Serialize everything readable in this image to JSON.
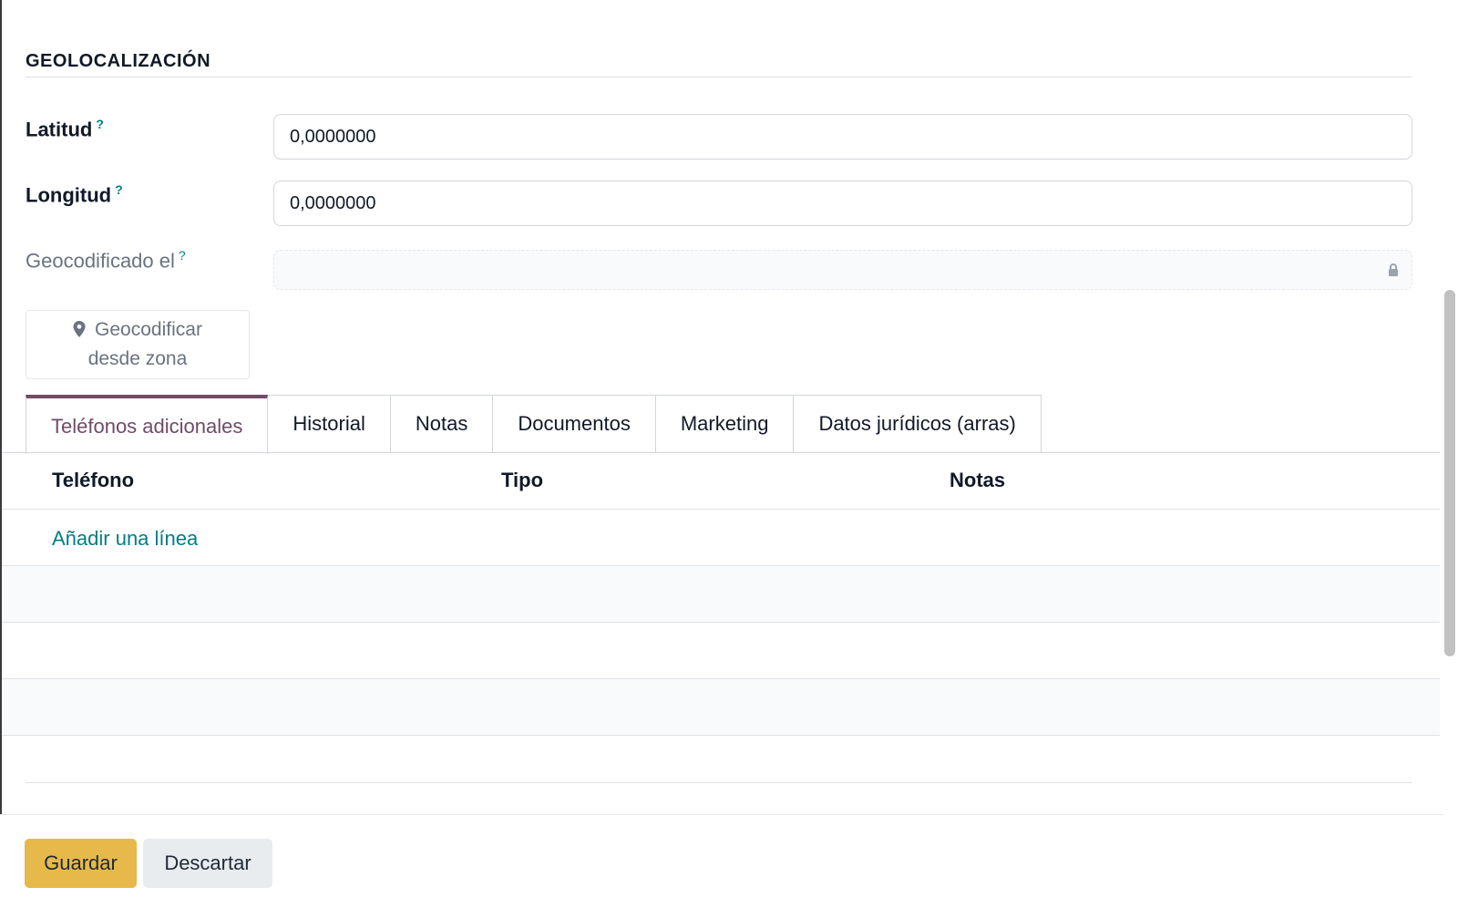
{
  "section": {
    "title": "GEOLOCALIZACIÓN"
  },
  "fields": {
    "latitude": {
      "label": "Latitud",
      "help": "?",
      "value": "0,0000000"
    },
    "longitude": {
      "label": "Longitud",
      "help": "?",
      "value": "0,0000000"
    },
    "geocoded_on": {
      "label": "Geocodificado el",
      "help": "?",
      "value": ""
    }
  },
  "geocode_button": {
    "line1": "Geocodificar",
    "line2": "desde zona",
    "icon": "map-marker-icon"
  },
  "tabs": [
    {
      "label": "Teléfonos adicionales",
      "active": true
    },
    {
      "label": "Historial",
      "active": false
    },
    {
      "label": "Notas",
      "active": false
    },
    {
      "label": "Documentos",
      "active": false
    },
    {
      "label": "Marketing",
      "active": false
    },
    {
      "label": "Datos jurídicos (arras)",
      "active": false
    }
  ],
  "table": {
    "columns": [
      "Teléfono",
      "Tipo",
      "Notas"
    ],
    "add_line": "Añadir una línea"
  },
  "footer": {
    "save": "Guardar",
    "discard": "Descartar"
  },
  "colors": {
    "accent": "#714b67",
    "link": "#017e84",
    "save_button": "#e6b94a"
  }
}
